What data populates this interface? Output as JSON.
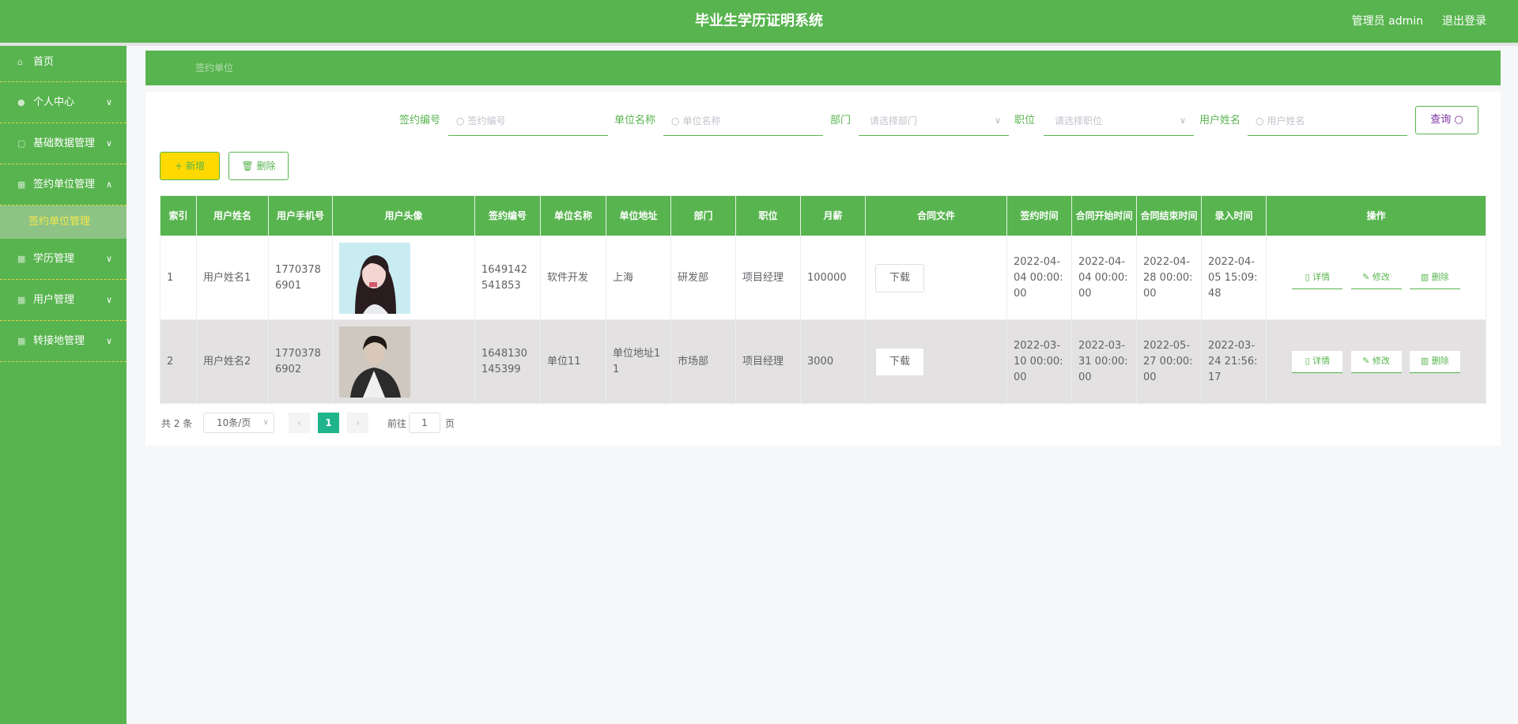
{
  "header": {
    "title": "毕业生学历证明系统",
    "user": "管理员 admin",
    "logout": "退出登录"
  },
  "sidebar": {
    "items": [
      {
        "label": "首页",
        "icon": "home-icon",
        "chevron": ""
      },
      {
        "label": "个人中心",
        "icon": "user-icon",
        "chevron": "﹀"
      },
      {
        "label": "基础数据管理",
        "icon": "grid-icon",
        "chevron": "﹀"
      },
      {
        "label": "签约单位管理",
        "icon": "grid-icon",
        "chevron": "︿"
      },
      {
        "label": "学历管理",
        "icon": "grid-icon",
        "chevron": "﹀"
      },
      {
        "label": "用户管理",
        "icon": "grid-icon",
        "chevron": "﹀"
      },
      {
        "label": "转接地管理",
        "icon": "grid-icon",
        "chevron": "﹀"
      }
    ],
    "active_sub": "签约单位管理"
  },
  "breadcrumb": "签约单位",
  "search": {
    "sign_no_label": "签约编号",
    "sign_no_placeholder": "签约编号",
    "unit_label": "单位名称",
    "unit_placeholder": "单位名称",
    "dept_label": "部门",
    "dept_placeholder": "请选择部门",
    "pos_label": "职位",
    "pos_placeholder": "请选择职位",
    "user_label": "用户姓名",
    "user_placeholder": "用户姓名",
    "query": "查询"
  },
  "actions": {
    "add": "新增",
    "delete": "删除"
  },
  "table": {
    "headers": [
      "索引",
      "用户姓名",
      "用户手机号",
      "用户头像",
      "签约编号",
      "单位名称",
      "单位地址",
      "部门",
      "职位",
      "月薪",
      "合同文件",
      "签约时间",
      "合同开始时间",
      "合同结束时间",
      "录入时间",
      "操作"
    ],
    "rows": [
      {
        "index": "1",
        "name": "用户姓名1",
        "phone": "17703786901",
        "sign_no": "1649142541853",
        "unit": "软件开发",
        "address": "上海",
        "dept": "研发部",
        "pos": "项目经理",
        "salary": "100000",
        "download": "下载",
        "sign_time": "2022-04-04 00:00:00",
        "start": "2022-04-04 00:00:00",
        "end": "2022-04-28 00:00:00",
        "entry": "2022-04-05 15:09:48"
      },
      {
        "index": "2",
        "name": "用户姓名2",
        "phone": "17703786902",
        "sign_no": "1648130145399",
        "unit": "单位11",
        "address": "单位地址11",
        "dept": "市场部",
        "pos": "项目经理",
        "salary": "3000",
        "download": "下载",
        "sign_time": "2022-03-10 00:00:00",
        "start": "2022-03-31 00:00:00",
        "end": "2022-05-27 00:00:00",
        "entry": "2022-03-24 21:56:17"
      }
    ],
    "ops": {
      "detail": "详情",
      "edit": "修改",
      "delete": "删除"
    }
  },
  "pager": {
    "total": "共 2 条",
    "size": "10条/页",
    "current": "1",
    "goto": "前往",
    "goto_value": "1",
    "suffix": "页"
  }
}
